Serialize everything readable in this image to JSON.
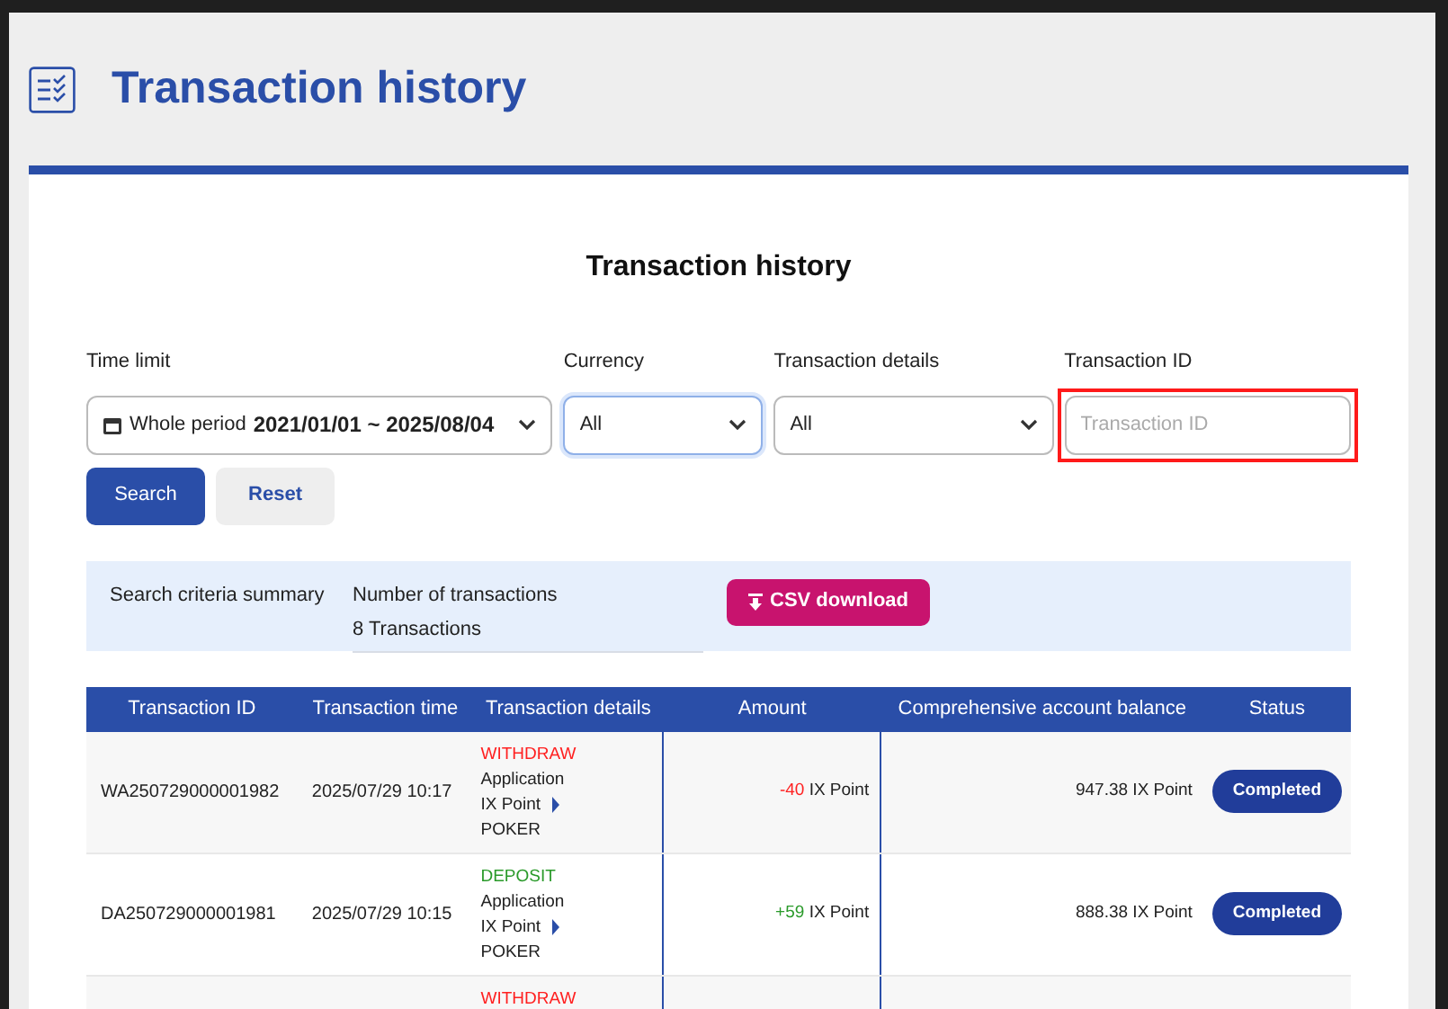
{
  "page": {
    "title": "Transaction history"
  },
  "card": {
    "title": "Transaction history"
  },
  "filters": [
    {
      "kind": "period",
      "label": "Time limit",
      "prefix": "Whole period",
      "value": "2021/01/01 ~ 2025/08/04",
      "focused": false
    },
    {
      "kind": "select",
      "label": "Currency",
      "value": "All",
      "focused": true
    },
    {
      "kind": "select",
      "label": "Transaction details",
      "value": "All",
      "focused": false
    },
    {
      "kind": "input",
      "label": "Transaction ID",
      "placeholder": "Transaction ID",
      "highlighted": true
    }
  ],
  "buttons": [
    {
      "kind": "primary",
      "label": "Search"
    },
    {
      "kind": "secondary",
      "label": "Reset"
    }
  ],
  "summary": {
    "label": "Search criteria summary",
    "count_label": "Number of transactions",
    "count": "8 Transactions",
    "download": "CSV download"
  },
  "table": {
    "columns": [
      "Transaction ID",
      "Transaction time",
      "Transaction details",
      "Amount",
      "Comprehensive account balance",
      "Status"
    ],
    "rows": [
      {
        "id": "WA250729000001982",
        "time": "2025/07/29 10:17",
        "type": "WITHDRAW",
        "color": "#ff2020",
        "details": [
          "Application",
          "IX Point",
          "POKER"
        ],
        "amount": "-40",
        "unit": "IX Point",
        "balance": "947.38 IX Point",
        "status": "Completed"
      },
      {
        "id": "DA250729000001981",
        "time": "2025/07/29 10:15",
        "type": "DEPOSIT",
        "color": "#2a9a2a",
        "details": [
          "Application",
          "IX Point",
          "POKER"
        ],
        "amount": "+59",
        "unit": "IX Point",
        "balance": "888.38 IX Point",
        "status": "Completed"
      },
      {
        "type": "WITHDRAW",
        "color": "#ff2020"
      }
    ]
  }
}
